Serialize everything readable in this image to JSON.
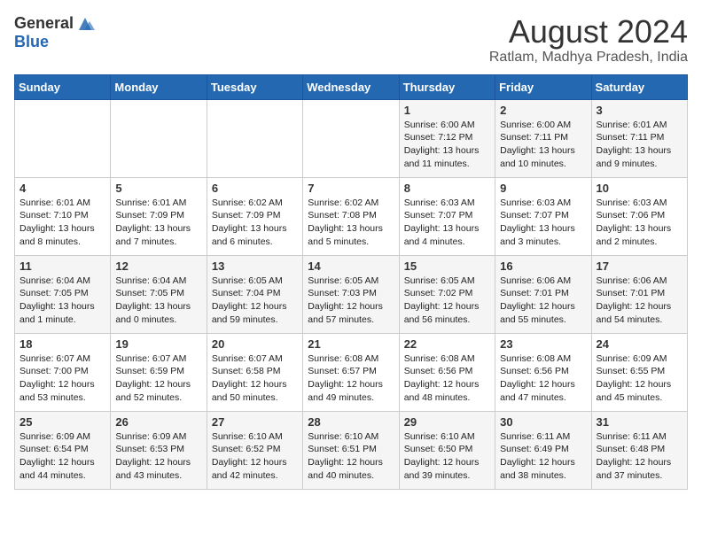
{
  "logo": {
    "general": "General",
    "blue": "Blue"
  },
  "title": "August 2024",
  "location": "Ratlam, Madhya Pradesh, India",
  "weekdays": [
    "Sunday",
    "Monday",
    "Tuesday",
    "Wednesday",
    "Thursday",
    "Friday",
    "Saturday"
  ],
  "weeks": [
    [
      {
        "day": "",
        "sunrise": "",
        "sunset": "",
        "daylight": ""
      },
      {
        "day": "",
        "sunrise": "",
        "sunset": "",
        "daylight": ""
      },
      {
        "day": "",
        "sunrise": "",
        "sunset": "",
        "daylight": ""
      },
      {
        "day": "",
        "sunrise": "",
        "sunset": "",
        "daylight": ""
      },
      {
        "day": "1",
        "sunrise": "Sunrise: 6:00 AM",
        "sunset": "Sunset: 7:12 PM",
        "daylight": "Daylight: 13 hours and 11 minutes."
      },
      {
        "day": "2",
        "sunrise": "Sunrise: 6:00 AM",
        "sunset": "Sunset: 7:11 PM",
        "daylight": "Daylight: 13 hours and 10 minutes."
      },
      {
        "day": "3",
        "sunrise": "Sunrise: 6:01 AM",
        "sunset": "Sunset: 7:11 PM",
        "daylight": "Daylight: 13 hours and 9 minutes."
      }
    ],
    [
      {
        "day": "4",
        "sunrise": "Sunrise: 6:01 AM",
        "sunset": "Sunset: 7:10 PM",
        "daylight": "Daylight: 13 hours and 8 minutes."
      },
      {
        "day": "5",
        "sunrise": "Sunrise: 6:01 AM",
        "sunset": "Sunset: 7:09 PM",
        "daylight": "Daylight: 13 hours and 7 minutes."
      },
      {
        "day": "6",
        "sunrise": "Sunrise: 6:02 AM",
        "sunset": "Sunset: 7:09 PM",
        "daylight": "Daylight: 13 hours and 6 minutes."
      },
      {
        "day": "7",
        "sunrise": "Sunrise: 6:02 AM",
        "sunset": "Sunset: 7:08 PM",
        "daylight": "Daylight: 13 hours and 5 minutes."
      },
      {
        "day": "8",
        "sunrise": "Sunrise: 6:03 AM",
        "sunset": "Sunset: 7:07 PM",
        "daylight": "Daylight: 13 hours and 4 minutes."
      },
      {
        "day": "9",
        "sunrise": "Sunrise: 6:03 AM",
        "sunset": "Sunset: 7:07 PM",
        "daylight": "Daylight: 13 hours and 3 minutes."
      },
      {
        "day": "10",
        "sunrise": "Sunrise: 6:03 AM",
        "sunset": "Sunset: 7:06 PM",
        "daylight": "Daylight: 13 hours and 2 minutes."
      }
    ],
    [
      {
        "day": "11",
        "sunrise": "Sunrise: 6:04 AM",
        "sunset": "Sunset: 7:05 PM",
        "daylight": "Daylight: 13 hours and 1 minute."
      },
      {
        "day": "12",
        "sunrise": "Sunrise: 6:04 AM",
        "sunset": "Sunset: 7:05 PM",
        "daylight": "Daylight: 13 hours and 0 minutes."
      },
      {
        "day": "13",
        "sunrise": "Sunrise: 6:05 AM",
        "sunset": "Sunset: 7:04 PM",
        "daylight": "Daylight: 12 hours and 59 minutes."
      },
      {
        "day": "14",
        "sunrise": "Sunrise: 6:05 AM",
        "sunset": "Sunset: 7:03 PM",
        "daylight": "Daylight: 12 hours and 57 minutes."
      },
      {
        "day": "15",
        "sunrise": "Sunrise: 6:05 AM",
        "sunset": "Sunset: 7:02 PM",
        "daylight": "Daylight: 12 hours and 56 minutes."
      },
      {
        "day": "16",
        "sunrise": "Sunrise: 6:06 AM",
        "sunset": "Sunset: 7:01 PM",
        "daylight": "Daylight: 12 hours and 55 minutes."
      },
      {
        "day": "17",
        "sunrise": "Sunrise: 6:06 AM",
        "sunset": "Sunset: 7:01 PM",
        "daylight": "Daylight: 12 hours and 54 minutes."
      }
    ],
    [
      {
        "day": "18",
        "sunrise": "Sunrise: 6:07 AM",
        "sunset": "Sunset: 7:00 PM",
        "daylight": "Daylight: 12 hours and 53 minutes."
      },
      {
        "day": "19",
        "sunrise": "Sunrise: 6:07 AM",
        "sunset": "Sunset: 6:59 PM",
        "daylight": "Daylight: 12 hours and 52 minutes."
      },
      {
        "day": "20",
        "sunrise": "Sunrise: 6:07 AM",
        "sunset": "Sunset: 6:58 PM",
        "daylight": "Daylight: 12 hours and 50 minutes."
      },
      {
        "day": "21",
        "sunrise": "Sunrise: 6:08 AM",
        "sunset": "Sunset: 6:57 PM",
        "daylight": "Daylight: 12 hours and 49 minutes."
      },
      {
        "day": "22",
        "sunrise": "Sunrise: 6:08 AM",
        "sunset": "Sunset: 6:56 PM",
        "daylight": "Daylight: 12 hours and 48 minutes."
      },
      {
        "day": "23",
        "sunrise": "Sunrise: 6:08 AM",
        "sunset": "Sunset: 6:56 PM",
        "daylight": "Daylight: 12 hours and 47 minutes."
      },
      {
        "day": "24",
        "sunrise": "Sunrise: 6:09 AM",
        "sunset": "Sunset: 6:55 PM",
        "daylight": "Daylight: 12 hours and 45 minutes."
      }
    ],
    [
      {
        "day": "25",
        "sunrise": "Sunrise: 6:09 AM",
        "sunset": "Sunset: 6:54 PM",
        "daylight": "Daylight: 12 hours and 44 minutes."
      },
      {
        "day": "26",
        "sunrise": "Sunrise: 6:09 AM",
        "sunset": "Sunset: 6:53 PM",
        "daylight": "Daylight: 12 hours and 43 minutes."
      },
      {
        "day": "27",
        "sunrise": "Sunrise: 6:10 AM",
        "sunset": "Sunset: 6:52 PM",
        "daylight": "Daylight: 12 hours and 42 minutes."
      },
      {
        "day": "28",
        "sunrise": "Sunrise: 6:10 AM",
        "sunset": "Sunset: 6:51 PM",
        "daylight": "Daylight: 12 hours and 40 minutes."
      },
      {
        "day": "29",
        "sunrise": "Sunrise: 6:10 AM",
        "sunset": "Sunset: 6:50 PM",
        "daylight": "Daylight: 12 hours and 39 minutes."
      },
      {
        "day": "30",
        "sunrise": "Sunrise: 6:11 AM",
        "sunset": "Sunset: 6:49 PM",
        "daylight": "Daylight: 12 hours and 38 minutes."
      },
      {
        "day": "31",
        "sunrise": "Sunrise: 6:11 AM",
        "sunset": "Sunset: 6:48 PM",
        "daylight": "Daylight: 12 hours and 37 minutes."
      }
    ]
  ]
}
